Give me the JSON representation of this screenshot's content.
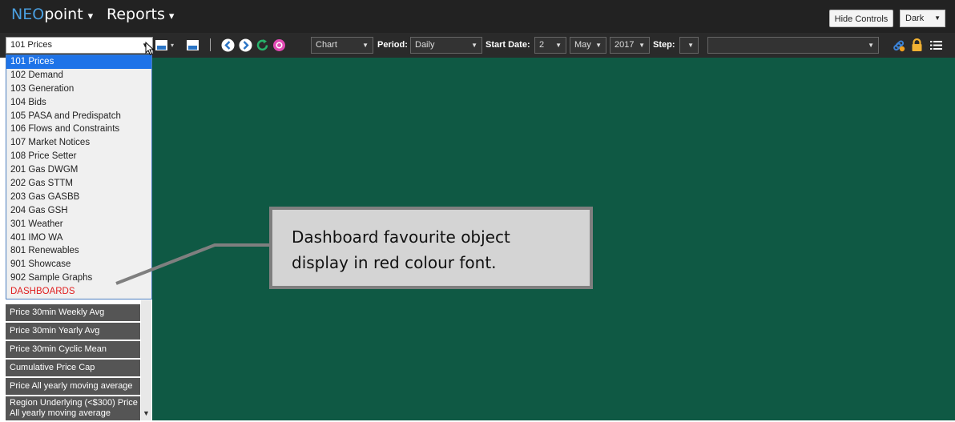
{
  "header": {
    "brand_prefix": "NEO",
    "brand_suffix": "point",
    "brand_caret": "▾",
    "reports_label": "Reports",
    "hide_controls_label": "Hide Controls",
    "theme_value": "Dark"
  },
  "toolbar": {
    "report_selected": "101 Prices",
    "view_value": "Chart",
    "period_label": "Period:",
    "period_value": "Daily",
    "start_date_label": "Start Date:",
    "day_value": "2",
    "month_value": "May",
    "year_value": "2017",
    "step_label": "Step:",
    "step_value": "",
    "extra_value": ""
  },
  "dropdown": {
    "items": [
      "101 Prices",
      "102 Demand",
      "103 Generation",
      "104 Bids",
      "105 PASA and Predispatch",
      "106 Flows and Constraints",
      "107 Market Notices",
      "108 Price Setter",
      "201 Gas DWGM",
      "202 Gas STTM",
      "203 Gas GASBB",
      "204 Gas GSH",
      "301 Weather",
      "401 IMO WA",
      "801 Renewables",
      "901 Showcase",
      "902 Sample Graphs",
      "DASHBOARDS"
    ]
  },
  "left_list": {
    "items": [
      "Price 30min Weekly Avg",
      "Price 30min Yearly Avg",
      "Price 30min Cyclic Mean",
      "Cumulative Price Cap",
      "Price All yearly moving average"
    ],
    "last_line1": "Region Underlying (<$300) Price",
    "last_line2": "All yearly moving average"
  },
  "callout": {
    "line1": "Dashboard favourite object",
    "line2": "display in red colour font."
  },
  "colors": {
    "canvas": "#0f5944",
    "active_item": "#1e73e8",
    "dashboards_red": "#e02020"
  }
}
